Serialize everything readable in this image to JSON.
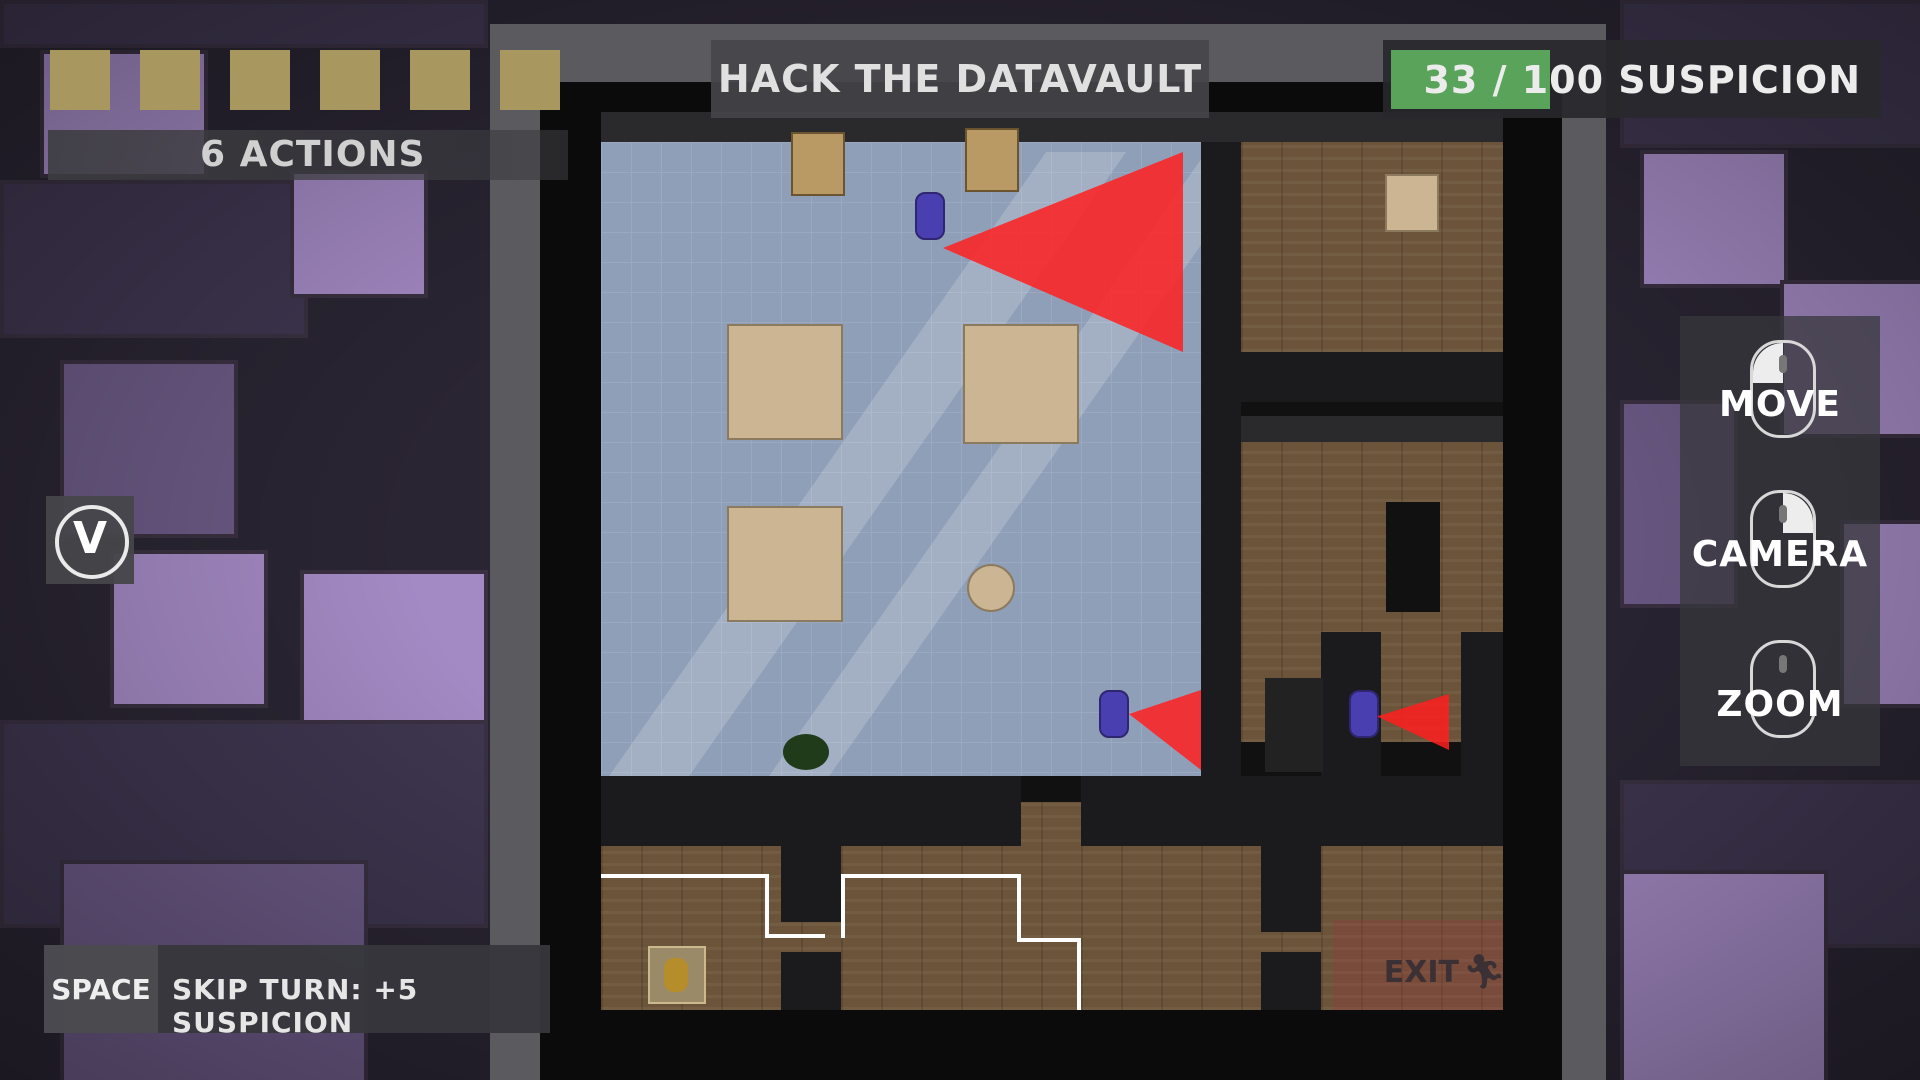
{
  "hud": {
    "action_squares": 6,
    "actions_label": "6 ACTIONS",
    "objective": "HACK THE DATAVAULT",
    "suspicion": {
      "current": "33",
      "separator": "/",
      "max_label": "100 SUSPICION",
      "fraction": 0.33
    },
    "view_toggle_key": "V"
  },
  "controls": [
    {
      "label": "MOVE",
      "icon": "mouse-left-click-icon"
    },
    {
      "label": "CAMERA",
      "icon": "mouse-right-click-icon"
    },
    {
      "label": "ZOOM",
      "icon": "mouse-scroll-icon"
    }
  ],
  "skip_turn": {
    "key": "SPACE",
    "description": "SKIP TURN: +5 SUSPICION"
  },
  "map": {
    "exit_label": "EXIT",
    "exit_icon": "running-person-icon"
  },
  "colors": {
    "suspicion_fill": "#5aa35a",
    "action_square": "#a8975f",
    "guard_cone": "#ff1e1e",
    "guard": "#4a3fb0"
  }
}
